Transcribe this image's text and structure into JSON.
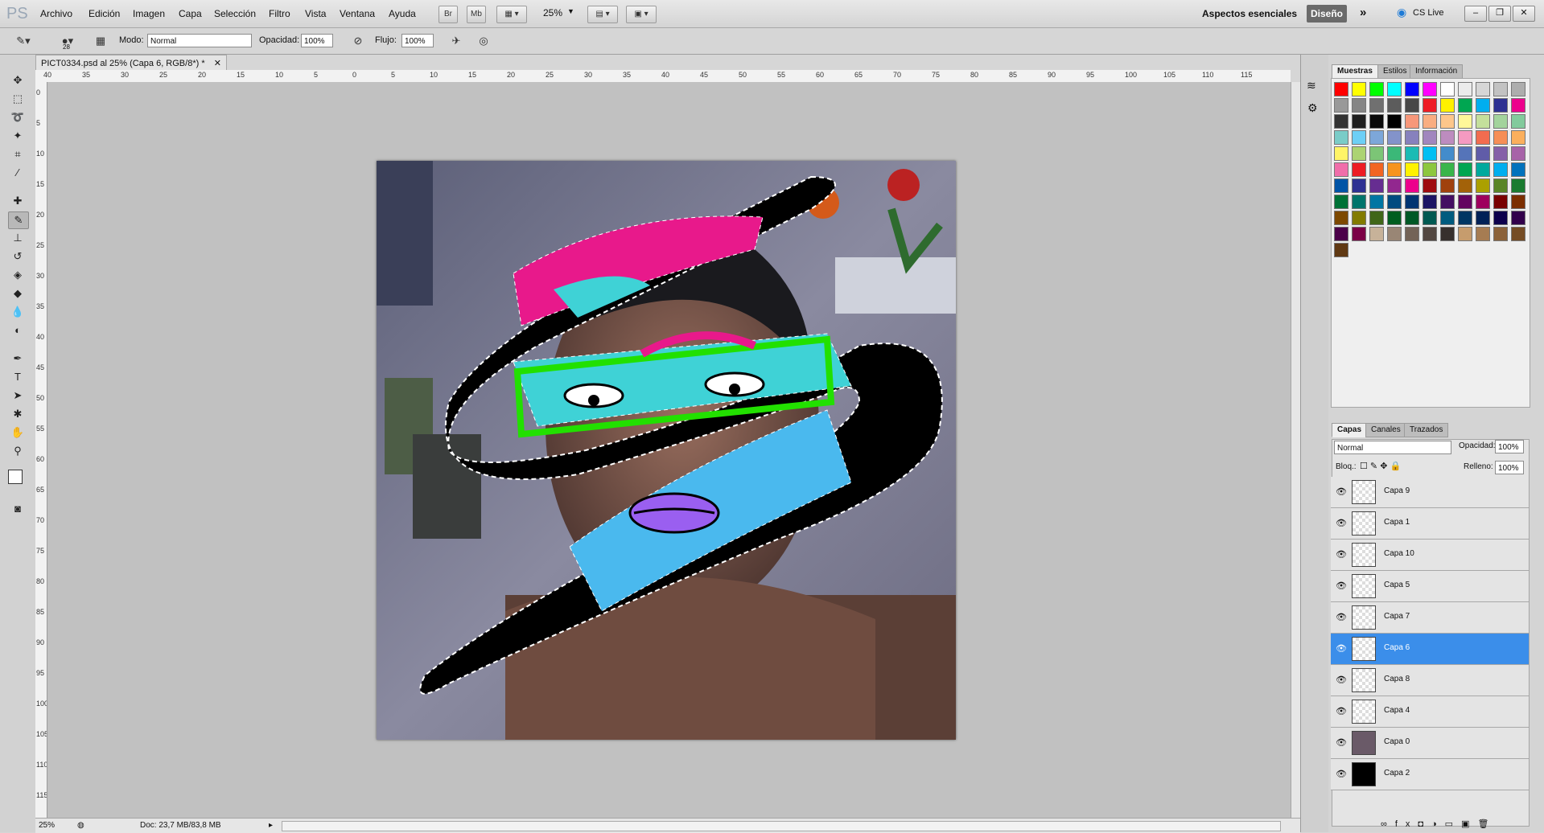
{
  "app": {
    "logo": "PS"
  },
  "menu": [
    "Archivo",
    "Edición",
    "Imagen",
    "Capa",
    "Selección",
    "Filtro",
    "Vista",
    "Ventana",
    "Ayuda"
  ],
  "toolbar_buttons": [
    "Br",
    "Mb"
  ],
  "zoom": "25%",
  "workspace": {
    "label": "Aspectos esenciales",
    "active": "Diseño",
    "cs_live": "CS Live"
  },
  "options": {
    "brush_size": "28",
    "mode_label": "Modo:",
    "mode_value": "Normal",
    "opacity_label": "Opacidad:",
    "opacity_value": "100%",
    "flow_label": "Flujo:",
    "flow_value": "100%"
  },
  "document": {
    "tab_title": "PICT0334.psd al 25% (Capa 6, RGB/8*) *",
    "status_zoom": "25%",
    "doc_info": "Doc: 23,7 MB/83,8 MB"
  },
  "ruler_top": [
    "40",
    "35",
    "30",
    "25",
    "20",
    "15",
    "10",
    "5",
    "0",
    "5",
    "10",
    "15",
    "20",
    "25",
    "30",
    "35",
    "40",
    "45",
    "50",
    "55",
    "60",
    "65",
    "70",
    "75",
    "80",
    "85",
    "90",
    "95",
    "100",
    "105",
    "110",
    "115"
  ],
  "ruler_left": [
    "0",
    "5",
    "10",
    "15",
    "20",
    "25",
    "30",
    "35",
    "40",
    "45",
    "50",
    "55",
    "60",
    "65",
    "70",
    "75",
    "80",
    "85",
    "90",
    "95",
    "100",
    "105",
    "110",
    "115"
  ],
  "panel_tabs_top": [
    "Muestras",
    "Estilos",
    "Información"
  ],
  "swatches": [
    "#ff0000",
    "#ffff00",
    "#00ff00",
    "#00ffff",
    "#0000ff",
    "#ff00ff",
    "#ffffff",
    "#ebebeb",
    "#d6d6d6",
    "#c2c2c2",
    "#adadad",
    "#999999",
    "#858585",
    "#707070",
    "#5c5c5c",
    "#474747",
    "#ee1c24",
    "#fff100",
    "#00a651",
    "#00aeef",
    "#2e3192",
    "#ec008c",
    "#333333",
    "#1f1f1f",
    "#0a0a0a",
    "#000000",
    "#f7977a",
    "#f9ad81",
    "#fdc68a",
    "#fff799",
    "#c4df9b",
    "#a3d39c",
    "#82ca9c",
    "#7accc8",
    "#6dcff6",
    "#7da7d9",
    "#8393ca",
    "#8781bd",
    "#a186be",
    "#bd8cbf",
    "#f49ac1",
    "#f26c4f",
    "#f68e55",
    "#fbaf5c",
    "#fff467",
    "#acd372",
    "#7cc576",
    "#3bb878",
    "#1abbb4",
    "#00bff3",
    "#438ccb",
    "#5574b9",
    "#605ca8",
    "#855fa8",
    "#a763a8",
    "#f06eaa",
    "#ed1c24",
    "#f26522",
    "#f7941d",
    "#fff200",
    "#8dc73f",
    "#39b54a",
    "#00a651",
    "#00a99d",
    "#00aeef",
    "#0072bc",
    "#0054a6",
    "#2e3192",
    "#662d91",
    "#92278f",
    "#ec008c",
    "#9e0b0f",
    "#a0410d",
    "#a36209",
    "#aba000",
    "#598527",
    "#1a7b30",
    "#007236",
    "#00746b",
    "#0076a3",
    "#004b80",
    "#003471",
    "#1b1464",
    "#440e62",
    "#630460",
    "#9e005d",
    "#790000",
    "#7b2e00",
    "#7d4900",
    "#827b00",
    "#406618",
    "#005e20",
    "#005826",
    "#005952",
    "#005b7f",
    "#003663",
    "#002157",
    "#0d004c",
    "#32004b",
    "#4b0049",
    "#7b0046",
    "#c7b299",
    "#998675",
    "#736357",
    "#534741",
    "#37302d",
    "#c69c6d",
    "#a67c52",
    "#8c6239",
    "#754c24",
    "#603913"
  ],
  "layers_tabs": [
    "Capas",
    "Canales",
    "Trazados"
  ],
  "layers_panel": {
    "blend": "Normal",
    "opacity_label": "Opacidad:",
    "opacity": "100%",
    "lock_label": "Bloq.:",
    "fill_label": "Relleno:",
    "fill": "100%"
  },
  "layers": [
    {
      "name": "Capa 9"
    },
    {
      "name": "Capa 1"
    },
    {
      "name": "Capa 10"
    },
    {
      "name": "Capa 5"
    },
    {
      "name": "Capa 7"
    },
    {
      "name": "Capa 6",
      "selected": true
    },
    {
      "name": "Capa 8"
    },
    {
      "name": "Capa 4"
    },
    {
      "name": "Capa 0"
    },
    {
      "name": "Capa 2"
    }
  ],
  "colors": {
    "selection_blue": "#3b8eea",
    "pink": "#e8198b",
    "cyan": "#3fd2d6",
    "blue": "#4ab9ee",
    "green": "#22e000",
    "purple": "#9a5ff0"
  }
}
